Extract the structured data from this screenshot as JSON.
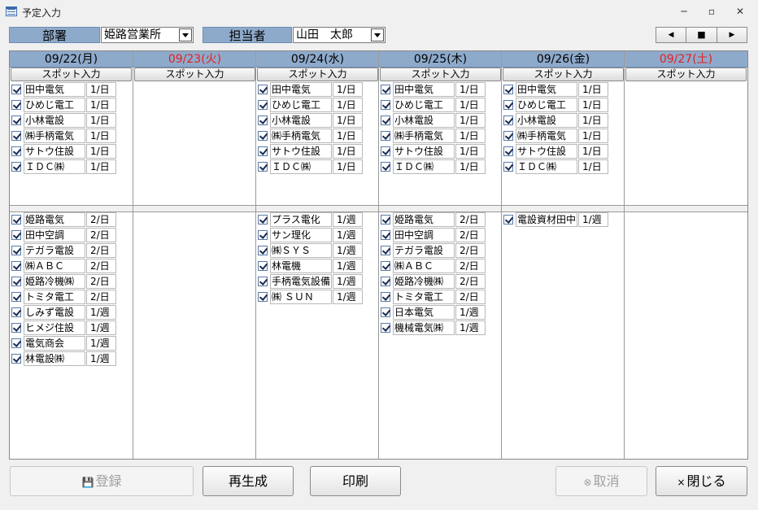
{
  "window": {
    "title": "予定入力",
    "minimize": "─",
    "restore": "▫",
    "close": "✕"
  },
  "header": {
    "dept_label": "部署",
    "dept_value": "姫路営業所",
    "person_label": "担当者",
    "person_value": "山田　太郎",
    "nav_prev": "◀",
    "nav_stop": "■",
    "nav_next": "▶"
  },
  "spot_label": "スポット入力",
  "days": [
    {
      "date": "09/22(月)",
      "holiday": false,
      "daily": [
        {
          "name": "田中電気",
          "freq": "1/日",
          "checked": true
        },
        {
          "name": "ひめじ電工",
          "freq": "1/日",
          "checked": true
        },
        {
          "name": "小林電設",
          "freq": "1/日",
          "checked": true
        },
        {
          "name": "㈱手柄電気",
          "freq": "1/日",
          "checked": true
        },
        {
          "name": "サトウ住設",
          "freq": "1/日",
          "checked": true
        },
        {
          "name": "ＩＤＣ㈱",
          "freq": "1/日",
          "checked": true
        }
      ],
      "regular": [
        {
          "name": "姫路電気",
          "freq": "2/日",
          "checked": true
        },
        {
          "name": "田中空調",
          "freq": "2/日",
          "checked": true
        },
        {
          "name": "テガラ電設",
          "freq": "2/日",
          "checked": true
        },
        {
          "name": "㈱ＡＢＣ",
          "freq": "2/日",
          "checked": true
        },
        {
          "name": "姫路冷機㈱",
          "freq": "2/日",
          "checked": true
        },
        {
          "name": "トミタ電工",
          "freq": "2/日",
          "checked": true
        },
        {
          "name": "しみず電設",
          "freq": "1/週",
          "checked": true
        },
        {
          "name": "ヒメジ住設",
          "freq": "1/週",
          "checked": true
        },
        {
          "name": "電気商会",
          "freq": "1/週",
          "checked": true
        },
        {
          "name": "林電設㈱",
          "freq": "1/週",
          "checked": true
        }
      ]
    },
    {
      "date": "09/23(火)",
      "holiday": true,
      "daily": [],
      "regular": []
    },
    {
      "date": "09/24(水)",
      "holiday": false,
      "daily": [
        {
          "name": "田中電気",
          "freq": "1/日",
          "checked": true
        },
        {
          "name": "ひめじ電工",
          "freq": "1/日",
          "checked": true
        },
        {
          "name": "小林電設",
          "freq": "1/日",
          "checked": true
        },
        {
          "name": "㈱手柄電気",
          "freq": "1/日",
          "checked": true
        },
        {
          "name": "サトウ住設",
          "freq": "1/日",
          "checked": true
        },
        {
          "name": "ＩＤＣ㈱",
          "freq": "1/日",
          "checked": true
        }
      ],
      "regular": [
        {
          "name": "プラス電化",
          "freq": "1/週",
          "checked": true
        },
        {
          "name": "サン理化",
          "freq": "1/週",
          "checked": true
        },
        {
          "name": "㈱ＳＹＳ",
          "freq": "1/週",
          "checked": true
        },
        {
          "name": "林電機",
          "freq": "1/週",
          "checked": true
        },
        {
          "name": "手柄電気設備",
          "freq": "1/週",
          "checked": true
        },
        {
          "name": "㈱ ＳＵＮ",
          "freq": "1/週",
          "checked": true
        }
      ]
    },
    {
      "date": "09/25(木)",
      "holiday": false,
      "daily": [
        {
          "name": "田中電気",
          "freq": "1/日",
          "checked": true
        },
        {
          "name": "ひめじ電工",
          "freq": "1/日",
          "checked": true
        },
        {
          "name": "小林電設",
          "freq": "1/日",
          "checked": true
        },
        {
          "name": "㈱手柄電気",
          "freq": "1/日",
          "checked": true
        },
        {
          "name": "サトウ住設",
          "freq": "1/日",
          "checked": true
        },
        {
          "name": "ＩＤＣ㈱",
          "freq": "1/日",
          "checked": true
        }
      ],
      "regular": [
        {
          "name": "姫路電気",
          "freq": "2/日",
          "checked": true
        },
        {
          "name": "田中空調",
          "freq": "2/日",
          "checked": true
        },
        {
          "name": "テガラ電設",
          "freq": "2/日",
          "checked": true
        },
        {
          "name": "㈱ＡＢＣ",
          "freq": "2/日",
          "checked": true
        },
        {
          "name": "姫路冷機㈱",
          "freq": "2/日",
          "checked": true
        },
        {
          "name": "トミタ電工",
          "freq": "2/日",
          "checked": true
        },
        {
          "name": "日本電気",
          "freq": "1/週",
          "checked": true
        },
        {
          "name": "機械電気㈱",
          "freq": "1/週",
          "checked": true
        }
      ]
    },
    {
      "date": "09/26(金)",
      "holiday": false,
      "daily": [
        {
          "name": "田中電気",
          "freq": "1/日",
          "checked": true
        },
        {
          "name": "ひめじ電工",
          "freq": "1/日",
          "checked": true
        },
        {
          "name": "小林電設",
          "freq": "1/日",
          "checked": true
        },
        {
          "name": "㈱手柄電気",
          "freq": "1/日",
          "checked": true
        },
        {
          "name": "サトウ住設",
          "freq": "1/日",
          "checked": true
        },
        {
          "name": "ＩＤＣ㈱",
          "freq": "1/日",
          "checked": true
        }
      ],
      "regular": [
        {
          "name": "電設資材田中",
          "freq": "1/週",
          "checked": true
        }
      ]
    },
    {
      "date": "09/27(土)",
      "holiday": true,
      "daily": [],
      "regular": []
    }
  ],
  "buttons": {
    "register": "登録",
    "regenerate": "再生成",
    "print": "印刷",
    "cancel": "取消",
    "close": "閉じる"
  },
  "icons": {
    "register": "save-icon",
    "cancel": "cancel-icon",
    "close": "close-x-icon"
  }
}
